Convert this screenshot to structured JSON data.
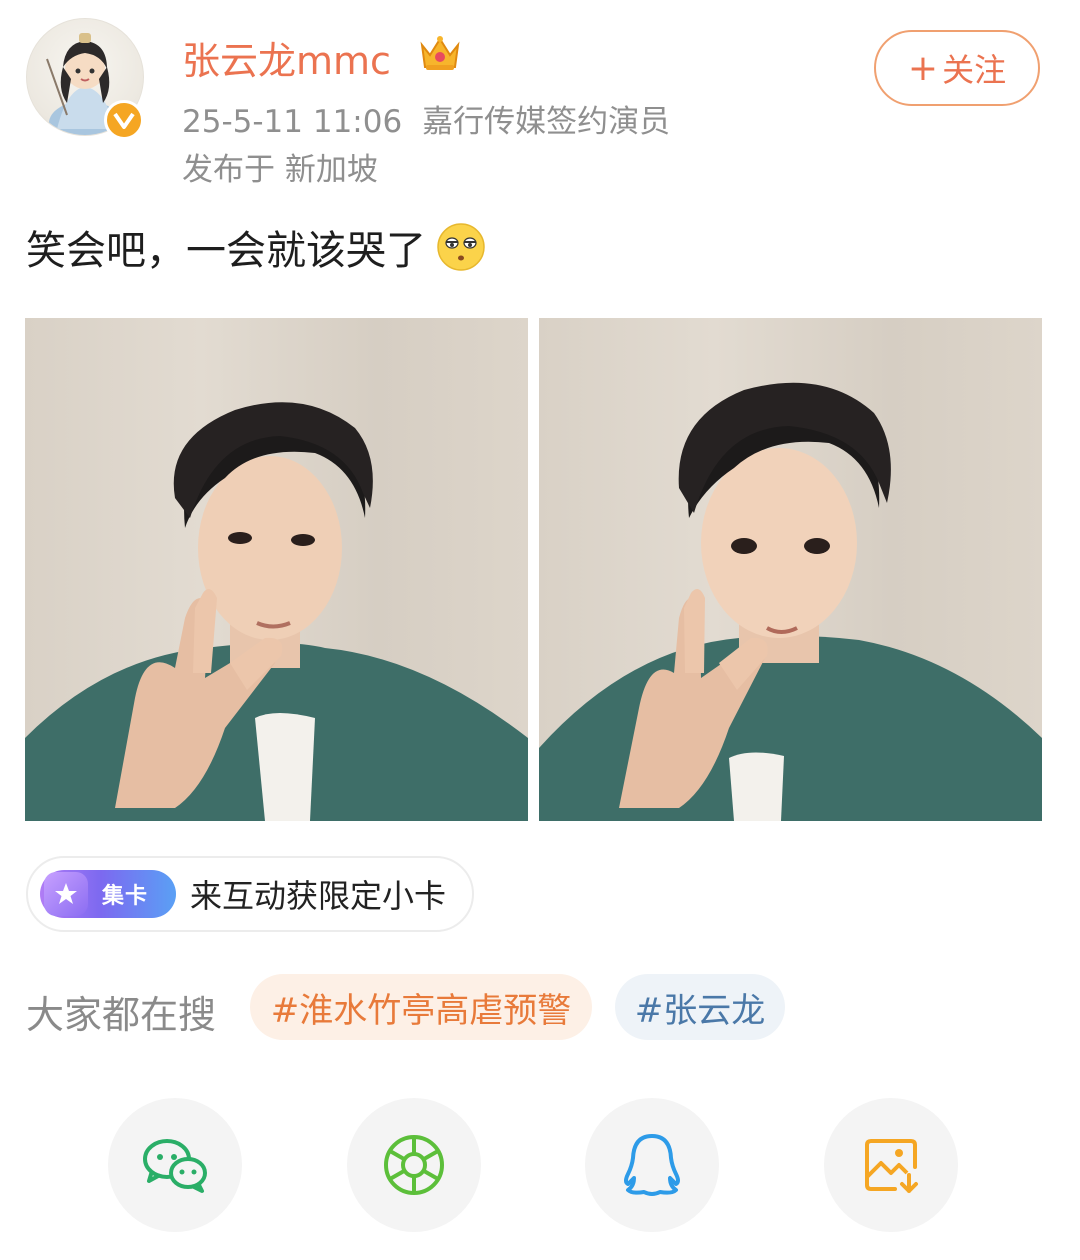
{
  "header": {
    "username": "张云龙mmc",
    "timestamp": "25-5-11 11:06",
    "verified_title": "嘉行传媒签约演员",
    "location": "发布于 新加坡",
    "follow_plus": "+",
    "follow_label": "关注"
  },
  "post": {
    "text": "笑会吧，一会就该哭了",
    "emoji": "eye-roll-emoji-icon"
  },
  "photos": [
    "selfie-peace-sign-1",
    "selfie-peace-sign-2"
  ],
  "card_chip": {
    "tag": "集卡",
    "text": "来互动获限定小卡"
  },
  "trending": {
    "label": "大家都在搜",
    "topics": [
      "#淮水竹亭高虐预警",
      "#张云龙"
    ]
  },
  "share": {
    "icons": [
      "wechat-icon",
      "moments-icon",
      "qq-icon",
      "save-image-icon"
    ]
  },
  "colors": {
    "accent": "#eb7350",
    "verified": "#f5a623",
    "topic_orange": "#e87a3a",
    "topic_blue": "#4a78a8",
    "wechat": "#2aae67",
    "moments": "#5cbf3a",
    "qq": "#2d9be8",
    "save": "#f5a623"
  }
}
